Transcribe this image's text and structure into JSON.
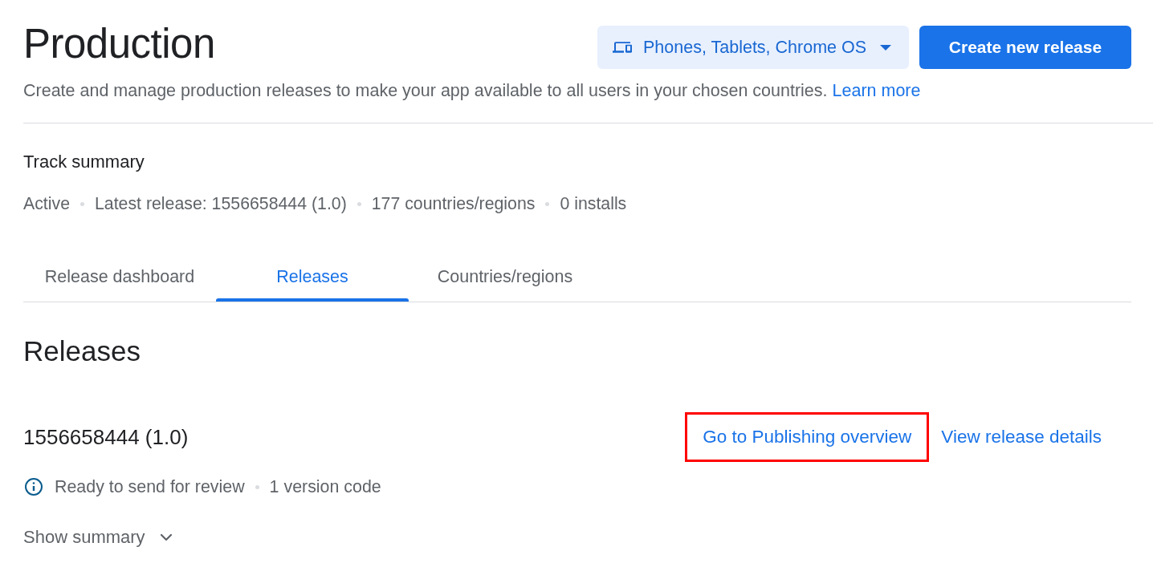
{
  "header": {
    "title": "Production",
    "device_selector": {
      "label": "Phones, Tablets, Chrome OS"
    },
    "primary_button": "Create new release",
    "description": {
      "text": "Create and manage production releases to make your app available to all users in your chosen countries.",
      "link": "Learn more"
    }
  },
  "track_summary": {
    "heading": "Track summary",
    "stats": [
      "Active",
      "Latest release: 1556658444 (1.0)",
      "177 countries/regions",
      "0 installs"
    ]
  },
  "tabs": [
    {
      "label": "Release dashboard",
      "selected": false
    },
    {
      "label": "Releases",
      "selected": true
    },
    {
      "label": "Countries/regions",
      "selected": false
    }
  ],
  "releases": {
    "heading": "Releases",
    "items": [
      {
        "name": "1556658444 (1.0)",
        "actions": [
          {
            "label": "Go to Publishing overview",
            "highlighted": true
          },
          {
            "label": "View release details",
            "highlighted": false
          }
        ],
        "status": "Ready to send for review",
        "details": [
          "1 version code"
        ],
        "expand_label": "Show summary",
        "expanded": false
      }
    ]
  }
}
